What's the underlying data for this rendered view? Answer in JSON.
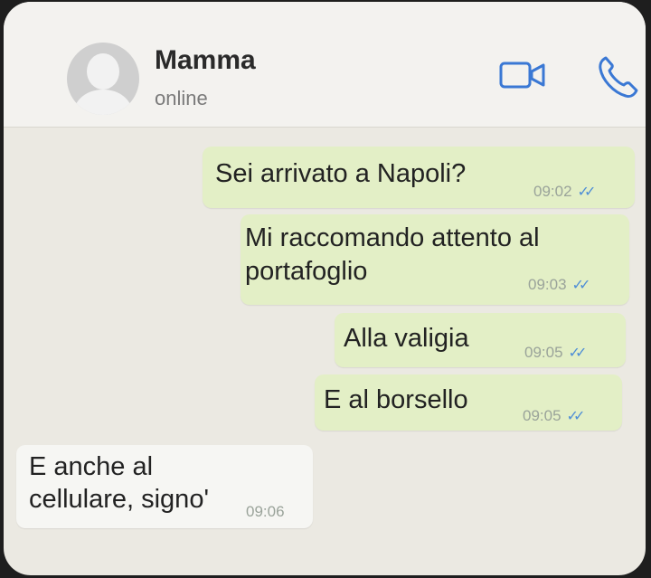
{
  "contact": {
    "name": "Mamma",
    "status": "online"
  },
  "header_icons": [
    "video-call-icon",
    "voice-call-icon"
  ],
  "messages": [
    {
      "direction": "out",
      "lines": [
        "Sei arrivato a Napoli?"
      ],
      "time": "09:02",
      "ticks": "✓✓"
    },
    {
      "direction": "out",
      "lines": [
        "Mi raccomando attento al",
        "portafoglio"
      ],
      "time": "09:03",
      "ticks": "✓✓"
    },
    {
      "direction": "out",
      "lines": [
        "Alla valigia"
      ],
      "time": "09:05",
      "ticks": "✓✓"
    },
    {
      "direction": "out",
      "lines": [
        "E al borsello"
      ],
      "time": "09:05",
      "ticks": "✓✓"
    },
    {
      "direction": "in",
      "lines": [
        "E anche al",
        "cellulare, signo'"
      ],
      "time": "09:06"
    }
  ],
  "colors": {
    "outgoing_bubble": "#e3efc6",
    "incoming_bubble": "#f6f6f3",
    "tick_blue": "#4f8ed6",
    "accent_icon": "#3a78d4"
  }
}
